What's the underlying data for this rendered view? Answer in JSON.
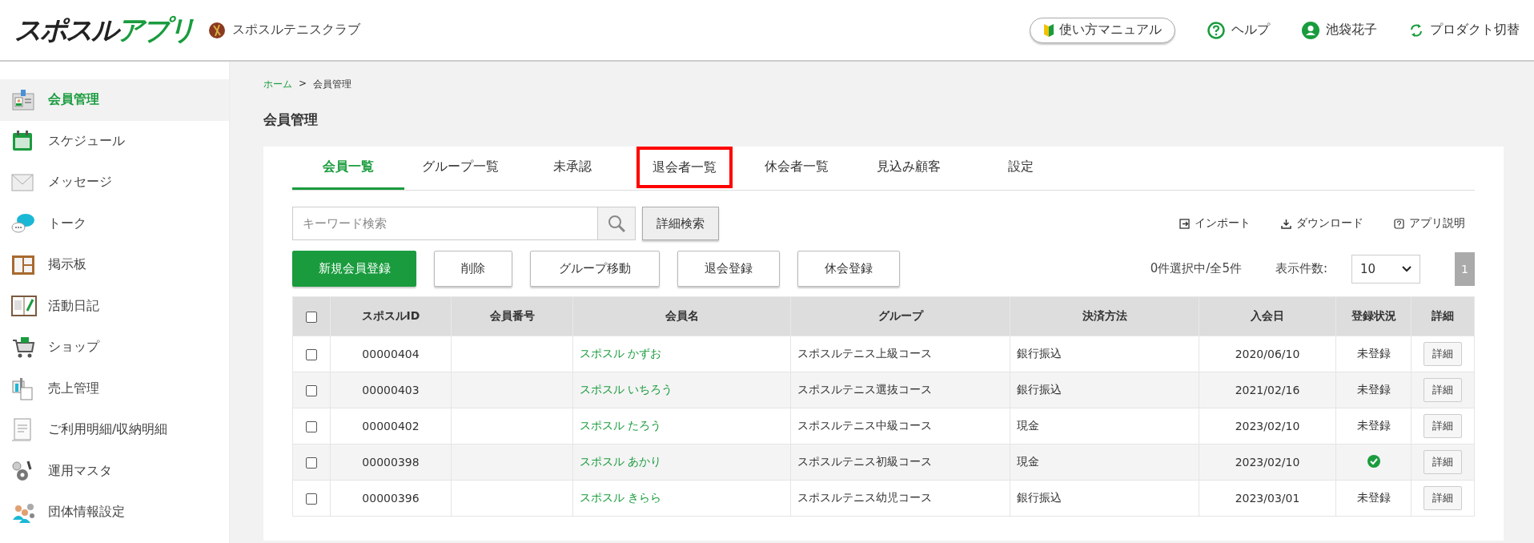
{
  "header": {
    "logo": {
      "main": "スポスル",
      "accent": "アプリ"
    },
    "club_name": "スポスルテニスクラブ",
    "manual_button": "使い方マニュアル",
    "help": "ヘルプ",
    "user": "池袋花子",
    "switch_product": "プロダクト切替"
  },
  "sidebar": {
    "items": [
      {
        "label": "会員管理",
        "selected": true
      },
      {
        "label": "スケジュール",
        "selected": false
      },
      {
        "label": "メッセージ",
        "selected": false
      },
      {
        "label": "トーク",
        "selected": false
      },
      {
        "label": "掲示板",
        "selected": false
      },
      {
        "label": "活動日記",
        "selected": false
      },
      {
        "label": "ショップ",
        "selected": false
      },
      {
        "label": "売上管理",
        "selected": false
      },
      {
        "label": "ご利用明細/収納明細",
        "selected": false
      },
      {
        "label": "運用マスタ",
        "selected": false
      },
      {
        "label": "団体情報設定",
        "selected": false
      }
    ]
  },
  "breadcrumb": {
    "home": "ホーム",
    "separator": ">",
    "current": "会員管理"
  },
  "page_title": "会員管理",
  "tabs": [
    {
      "label": "会員一覧",
      "selected": true,
      "highlighted": false
    },
    {
      "label": "グループ一覧",
      "selected": false,
      "highlighted": false
    },
    {
      "label": "未承認",
      "selected": false,
      "highlighted": false
    },
    {
      "label": "退会者一覧",
      "selected": false,
      "highlighted": true
    },
    {
      "label": "休会者一覧",
      "selected": false,
      "highlighted": false
    },
    {
      "label": "見込み顧客",
      "selected": false,
      "highlighted": false
    },
    {
      "label": "設定",
      "selected": false,
      "highlighted": false
    }
  ],
  "search": {
    "placeholder": "キーワード検索",
    "advanced_button": "詳細検索"
  },
  "links": [
    "インポート",
    "ダウンロード",
    "アプリ説明"
  ],
  "actions": [
    {
      "label": "新規会員登録",
      "kind": "primary"
    },
    {
      "label": "削除",
      "kind": "default"
    },
    {
      "label": "グループ移動",
      "kind": "default"
    },
    {
      "label": "退会登録",
      "kind": "default"
    },
    {
      "label": "休会登録",
      "kind": "default"
    }
  ],
  "selection_count": "0件選択中/全5件",
  "page_size": {
    "label": "表示件数:",
    "value": "10"
  },
  "pagination": [
    "1"
  ],
  "table": {
    "select_all_checked": false,
    "columns": [
      "スポスルID",
      "会員番号",
      "会員名",
      "グループ",
      "決済方法",
      "入会日",
      "登録状況",
      "詳細"
    ],
    "rows": [
      {
        "checked": false,
        "id": "00000404",
        "number": "",
        "name": "スポスル かずお",
        "group": "スポスルテニス上級コース",
        "payment": "銀行振込",
        "joined": "2020/06/10",
        "registered": false,
        "status": "未登録",
        "detail": "詳細"
      },
      {
        "checked": false,
        "id": "00000403",
        "number": "",
        "name": "スポスル いちろう",
        "group": "スポスルテニス選抜コース",
        "payment": "銀行振込",
        "joined": "2021/02/16",
        "registered": false,
        "status": "未登録",
        "detail": "詳細"
      },
      {
        "checked": false,
        "id": "00000402",
        "number": "",
        "name": "スポスル たろう",
        "group": "スポスルテニス中級コース",
        "payment": "現金",
        "joined": "2023/02/10",
        "registered": false,
        "status": "未登録",
        "detail": "詳細"
      },
      {
        "checked": false,
        "id": "00000398",
        "number": "",
        "name": "スポスル あかり",
        "group": "スポスルテニス初級コース",
        "payment": "現金",
        "joined": "2023/02/10",
        "registered": true,
        "detail": "詳細"
      },
      {
        "checked": false,
        "id": "00000396",
        "number": "",
        "name": "スポスル きらら",
        "group": "スポスルテニス幼児コース",
        "payment": "銀行振込",
        "joined": "2023/03/01",
        "registered": false,
        "status": "未登録",
        "detail": "詳細"
      }
    ]
  }
}
